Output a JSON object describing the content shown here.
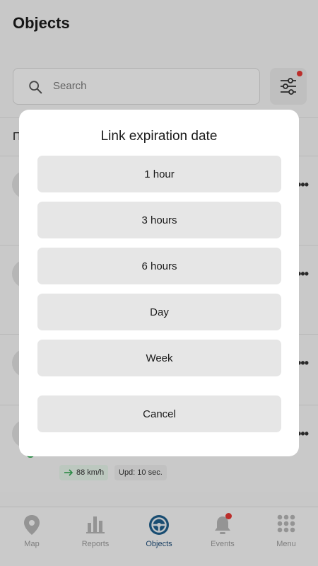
{
  "header": {
    "title": "Objects"
  },
  "search": {
    "placeholder": "Search",
    "icon": "search-icon"
  },
  "filter": {
    "icon": "filter-sliders-icon",
    "has_notification": true,
    "notification_color": "#e53935"
  },
  "list": {
    "header_fragment": "П",
    "last_row": {
      "speed": "88 km/h",
      "updated": "Upd: 10 sec.",
      "status_color": "#34a853"
    }
  },
  "dialog": {
    "title": "Link expiration date",
    "options": [
      "1 hour",
      "3 hours",
      "6 hours",
      "Day",
      "Week"
    ],
    "cancel": "Cancel"
  },
  "nav": {
    "items": [
      {
        "label": "Map",
        "icon": "map-pin-icon"
      },
      {
        "label": "Reports",
        "icon": "bar-chart-icon"
      },
      {
        "label": "Objects",
        "icon": "steering-wheel-icon",
        "active": true
      },
      {
        "label": "Events",
        "icon": "bell-icon",
        "has_notification": true
      },
      {
        "label": "Menu",
        "icon": "grid-menu-icon"
      }
    ],
    "active_color": "#1f5f8b"
  }
}
